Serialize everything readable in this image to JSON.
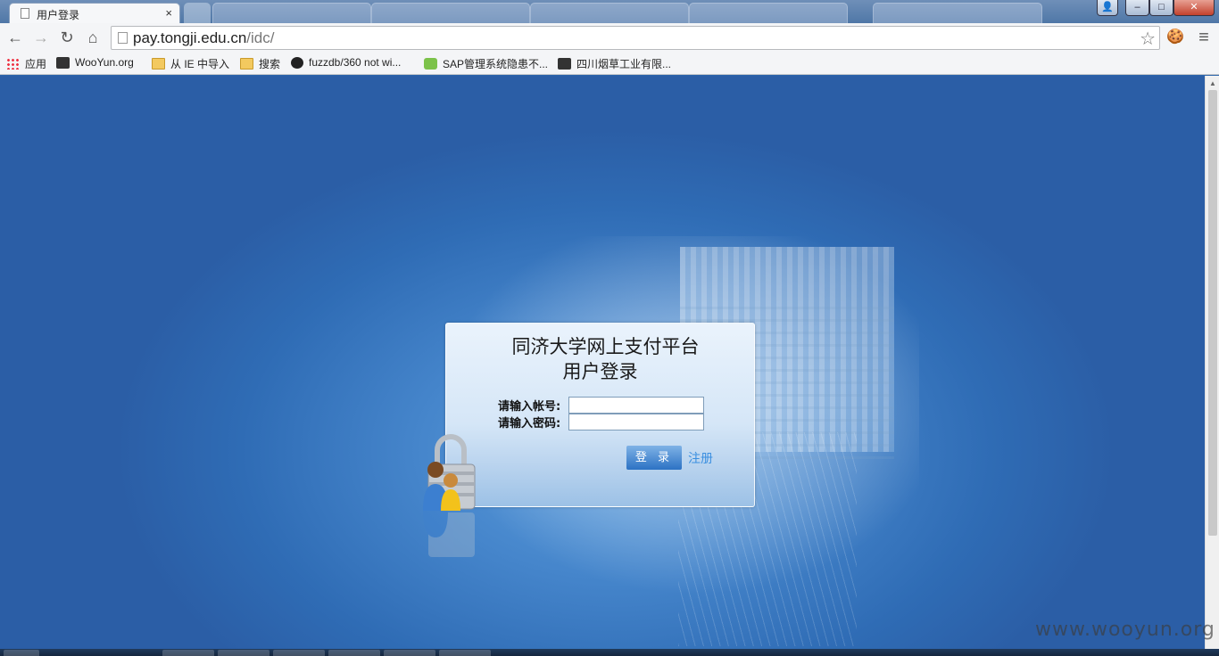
{
  "browser": {
    "active_tab_title": "用户登录",
    "tab_close": "×",
    "url_host": "pay.tongji.edu.cn",
    "url_path": "/idc/",
    "nav": {
      "back": "←",
      "forward": "→",
      "reload": "↻",
      "home": "⌂",
      "star": "☆",
      "menu": "≡"
    },
    "window_buttons": {
      "minimize": "–",
      "maximize": "□",
      "close": "✕"
    }
  },
  "bookmarks": [
    {
      "label": "应用",
      "icon": "apps-icon"
    },
    {
      "label": "WooYun.org",
      "icon": "wooyun-icon"
    },
    {
      "label": "从 IE 中导入",
      "icon": "folder-icon"
    },
    {
      "label": "搜索",
      "icon": "folder-icon"
    },
    {
      "label": "fuzzdb/360 not wi...",
      "icon": "github-icon"
    },
    {
      "label": "SAP管理系统隐患不...",
      "icon": "check-icon"
    },
    {
      "label": "四川烟草工业有限...",
      "icon": "wooyun-icon"
    }
  ],
  "login": {
    "title_line1": "同济大学网上支付平台",
    "title_line2": "用户登录",
    "account_label": "请输入帐号:",
    "password_label": "请输入密码:",
    "account_value": "",
    "password_value": "",
    "login_button": "登 录",
    "register_link": "注册"
  },
  "watermark": "www.wooyun.org"
}
